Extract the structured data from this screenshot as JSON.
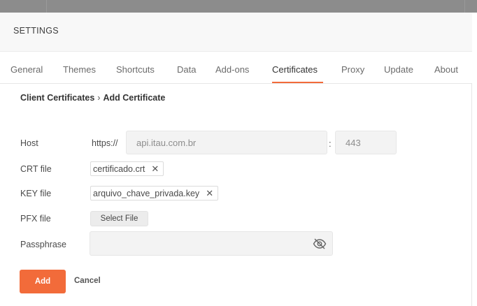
{
  "header": {
    "title": "SETTINGS"
  },
  "tabs": [
    {
      "label": "General"
    },
    {
      "label": "Themes"
    },
    {
      "label": "Shortcuts"
    },
    {
      "label": "Data"
    },
    {
      "label": "Add-ons"
    },
    {
      "label": "Certificates",
      "active": true
    },
    {
      "label": "Proxy"
    },
    {
      "label": "Update"
    },
    {
      "label": "About"
    }
  ],
  "breadcrumb": {
    "parent": "Client Certificates",
    "separator": "›",
    "current": "Add Certificate"
  },
  "form": {
    "host": {
      "label": "Host",
      "prefix": "https://",
      "value": "api.itau.com.br",
      "separator": ":",
      "port_placeholder": "443"
    },
    "crt": {
      "label": "CRT file",
      "value": "certificado.crt"
    },
    "key": {
      "label": "KEY file",
      "value": "arquivo_chave_privada.key"
    },
    "pfx": {
      "label": "PFX file",
      "button_label": "Select File"
    },
    "passphrase": {
      "label": "Passphrase",
      "value": "",
      "icon": "eye-off-icon"
    }
  },
  "actions": {
    "add_label": "Add",
    "cancel_label": "Cancel"
  },
  "colors": {
    "accent": "#f26b3a",
    "topbar": "#8c8c8c"
  }
}
